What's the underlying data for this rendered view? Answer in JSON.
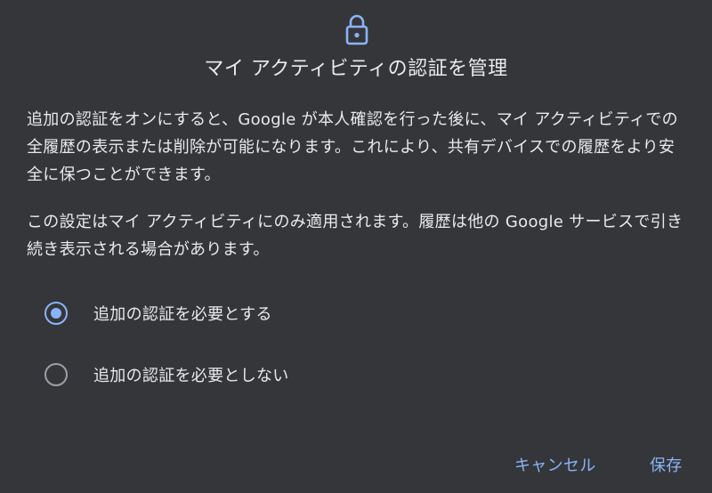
{
  "dialog": {
    "icon": "lock-icon",
    "title": "マイ アクティビティの認証を管理",
    "paragraph1": "追加の認証をオンにすると、Google が本人確認を行った後に、マイ アクティビティでの全履歴の表示または削除が可能になります。これにより、共有デバイスでの履歴をより安全に保つことができます。",
    "paragraph2": "この設定はマイ アクティビティにのみ適用されます。履歴は他の Google サービスで引き続き表示される場合があります。",
    "options": [
      {
        "label": "追加の認証を必要とする",
        "selected": true
      },
      {
        "label": "追加の認証を必要としない",
        "selected": false
      }
    ],
    "cancel_label": "キャンセル",
    "save_label": "保存"
  },
  "colors": {
    "background": "#35363a",
    "text": "#e8eaed",
    "accent": "#8ab4f8",
    "radio_unchecked": "#9aa0a6"
  }
}
